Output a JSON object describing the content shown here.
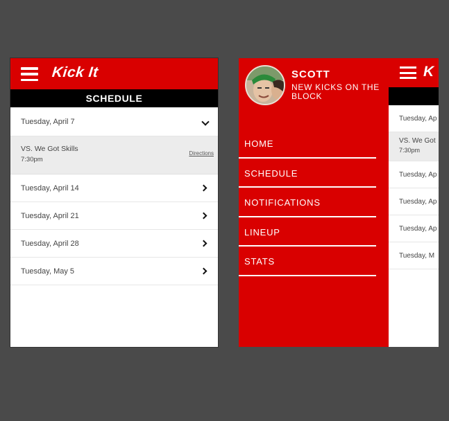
{
  "app": {
    "logo": "Kick It",
    "screen_title": "SCHEDULE"
  },
  "schedule": {
    "expanded_date": "Tuesday, April 7",
    "game": {
      "opponent": "VS. We Got Skills",
      "time": "7:30pm",
      "directions": "Directions"
    },
    "dates": [
      "Tuesday, April 14",
      "Tuesday, April 21",
      "Tuesday, April 28",
      "Tuesday, May 5"
    ]
  },
  "drawer": {
    "user_name": "SCOTT",
    "team_name": "NEW KICKS ON THE BLOCK",
    "menu": [
      "HOME",
      "SCHEDULE",
      "NOTIFICATIONS",
      "LINEUP",
      "STATS"
    ]
  },
  "peek": {
    "logo_fragment": "K",
    "rows": [
      "Tuesday, Ap",
      "Tuesday, Ap",
      "Tuesday, Ap",
      "Tuesday, Ap",
      "Tuesday, M"
    ],
    "game_opponent": "VS.  We Got",
    "game_time": "7:30pm"
  },
  "colors": {
    "brand": "#d90000",
    "title_bar": "#000000",
    "background": "#4a4a4a"
  },
  "icons": [
    "menu-icon",
    "chevron-down-icon",
    "chevron-right-icon",
    "avatar"
  ]
}
